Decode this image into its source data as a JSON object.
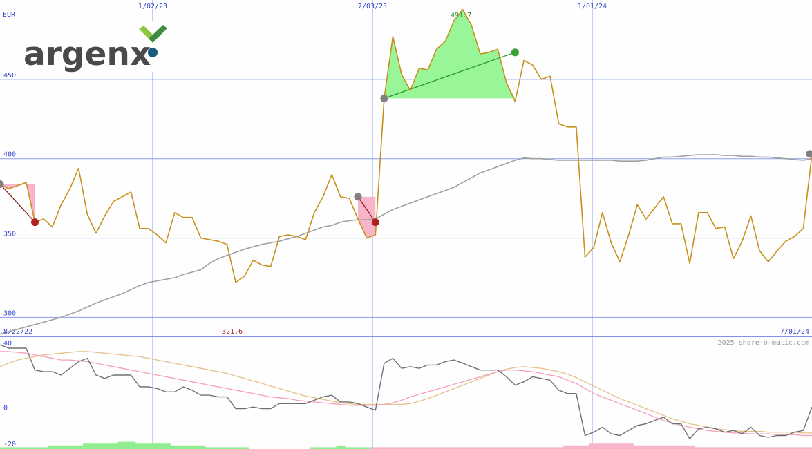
{
  "logo": {
    "text": "argenx",
    "mark_colors": {
      "chevron_light": "#8dc63f",
      "chevron_dark": "#3d8c40",
      "dot": "#1b5a7a",
      "text": "#4a4a4a"
    }
  },
  "watermark": "2025 share-o-matic.com",
  "colors": {
    "price": "#c8901a",
    "ma200": "#a0a0a0",
    "grid": "#8a9df0",
    "osc": "#707070",
    "osc_pink": "#f4a0b8",
    "osc_tan": "#e6c08a",
    "hist_pos": "#90ee90",
    "hist_neg": "#f8b4c8",
    "buy_dot": "#3aa03a",
    "sell_dot": "#b02020",
    "neutral_dot": "#808080",
    "gain_fill": "#98f598",
    "loss_fill": "#f8b4c8"
  },
  "chart_data": [
    {
      "type": "line",
      "currency_label": "EUR",
      "x_tick_labels": [
        "1/02/23",
        "7/03/23",
        "1/01/24"
      ],
      "y_ticks": [
        300,
        350,
        400,
        450
      ],
      "ylim": [
        288,
        500
      ],
      "start_label": "8/22/22",
      "end_label": "7/01/24",
      "min_label": "321.6",
      "max_label": "491.7",
      "grid": true,
      "series": [
        {
          "key": "price",
          "values": [
            384,
            381,
            383,
            385,
            360,
            362,
            357,
            371,
            381,
            394,
            365,
            353,
            364,
            373,
            376,
            379,
            356,
            356,
            352,
            347,
            366,
            363,
            363,
            350,
            349,
            348,
            346,
            322,
            326,
            336,
            333,
            332,
            351,
            352,
            351,
            349,
            366,
            376,
            390,
            376,
            375,
            362,
            350,
            352,
            438,
            477,
            453,
            443,
            457,
            456,
            469,
            474,
            487,
            494,
            484,
            466,
            467,
            469,
            448,
            436,
            462,
            459,
            450,
            452,
            422,
            420,
            420,
            338,
            344,
            366,
            347,
            335,
            352,
            371,
            362,
            369,
            376,
            359,
            359,
            334,
            366,
            366,
            356,
            357,
            337,
            348,
            364,
            342,
            335,
            342,
            348,
            351,
            356,
            403
          ]
        },
        {
          "key": "ma200",
          "values": [
            289.5,
            291,
            292.5,
            294,
            295.5,
            297,
            298.5,
            300,
            302,
            304,
            306.5,
            309,
            311,
            313,
            315,
            317.5,
            320,
            322,
            323,
            324,
            325,
            327,
            328.5,
            330,
            334,
            337,
            339,
            341,
            343,
            344.5,
            346,
            347,
            348,
            349.5,
            351,
            353,
            355,
            357,
            358,
            360,
            361,
            361.5,
            361.5,
            362,
            365,
            368,
            370,
            372,
            374,
            376,
            378,
            380,
            382,
            385,
            388,
            391,
            393,
            395,
            397,
            399,
            400.5,
            400,
            400,
            399.5,
            399,
            399,
            399,
            399,
            399,
            399,
            399,
            398.5,
            398.5,
            398.5,
            399,
            400,
            401,
            401,
            401.5,
            402,
            402.5,
            402.5,
            402.5,
            402,
            402,
            401.5,
            401.5,
            401,
            401,
            400.5,
            400,
            399.5,
            399,
            400
          ]
        }
      ],
      "signals": [
        {
          "from_index": 0,
          "from_value": 384,
          "to_index": 4,
          "to_value": 360,
          "result": "loss"
        },
        {
          "from_index": 41,
          "from_value": 376,
          "to_index": 43,
          "to_value": 360,
          "result": "loss"
        },
        {
          "from_index": 44,
          "from_value": 438,
          "to_index": 59,
          "to_value": 467,
          "result": "gain"
        }
      ],
      "last_marker_value": 403
    },
    {
      "type": "line",
      "y_ticks": [
        40,
        0,
        -20
      ],
      "ylim": [
        -22,
        45
      ],
      "grid": true,
      "series": [
        {
          "key": "oscillator",
          "values": [
            40,
            38,
            38,
            38,
            25,
            24,
            24,
            22,
            26,
            30,
            32,
            22,
            20,
            22,
            22,
            22,
            15,
            15,
            14,
            12,
            12,
            15,
            13,
            10,
            10,
            9,
            9,
            2,
            2,
            3,
            2,
            2,
            5,
            5,
            5,
            5,
            7,
            9,
            10,
            6,
            6,
            5,
            3,
            1,
            29,
            32,
            26,
            27,
            26,
            28,
            28,
            30,
            31,
            29,
            27,
            25,
            25,
            25,
            21,
            16,
            18,
            21,
            20,
            19,
            13,
            11,
            11,
            -14,
            -12,
            -9,
            -13,
            -14,
            -11,
            -8,
            -7,
            -5,
            -3,
            -7,
            -7,
            -16,
            -10,
            -9,
            -10,
            -12,
            -11,
            -13,
            -9,
            -14,
            -15,
            -14,
            -14,
            -12,
            -11,
            3
          ]
        },
        {
          "key": "signal_line",
          "values": [
            36,
            36,
            35.5,
            35,
            34,
            33,
            32,
            31,
            31,
            30.5,
            30,
            29,
            28,
            27,
            26,
            25,
            24,
            23,
            22,
            21,
            20,
            19,
            18,
            17,
            16,
            15,
            14,
            13,
            12,
            11,
            10,
            9,
            8.5,
            8,
            7,
            6.5,
            6,
            5.5,
            5,
            4.5,
            4,
            4,
            4,
            4,
            4.5,
            5.5,
            7,
            9,
            10.5,
            12,
            13.5,
            15,
            16.5,
            18,
            19.5,
            21,
            22.5,
            24,
            25,
            25,
            24.5,
            24,
            23,
            22,
            21,
            19,
            17,
            14,
            11,
            9,
            7,
            5,
            3,
            1,
            -1,
            -3,
            -5,
            -6.5,
            -8,
            -9,
            -10,
            -11,
            -11.5,
            -12,
            -12.5,
            -12.5,
            -13,
            -13,
            -13,
            -13.5,
            -13.5,
            -13.5,
            -14,
            -14
          ]
        },
        {
          "key": "slow_line",
          "values": [
            27,
            29,
            31,
            32,
            33,
            34,
            34.5,
            35,
            35.5,
            36,
            36,
            35.5,
            35,
            34.5,
            34,
            33.5,
            33,
            32,
            31,
            30,
            29,
            28,
            27,
            26,
            25,
            24,
            23,
            21.5,
            20,
            18.5,
            17,
            15.5,
            14,
            12.5,
            11,
            9.5,
            8.5,
            7.5,
            6.5,
            5.5,
            5,
            4.5,
            4.5,
            4.5,
            4.5,
            4.5,
            4.5,
            5,
            6.5,
            8,
            10,
            12,
            14,
            16,
            18,
            20,
            22,
            24,
            25.5,
            26.5,
            27,
            26.5,
            26,
            25,
            24,
            22.5,
            20.5,
            18,
            15.5,
            13,
            10.5,
            8,
            6,
            4,
            2,
            0,
            -2,
            -4,
            -5.5,
            -7,
            -8,
            -9,
            -10,
            -10.5,
            -11,
            -11.5,
            -11.5,
            -11.5,
            -12,
            -12,
            -12,
            -12,
            -12.5,
            -12.5
          ]
        }
      ],
      "histogram": [
        1,
        1,
        1,
        1,
        1,
        1,
        2,
        2,
        2,
        2,
        3,
        3,
        3,
        3,
        4,
        4,
        3,
        3,
        3,
        3,
        2,
        2,
        2,
        2,
        1,
        1,
        1,
        1,
        1,
        0,
        0,
        0,
        0,
        0,
        0,
        0,
        1,
        1,
        1,
        2,
        1,
        1,
        1,
        -1,
        -1,
        -1,
        -1,
        -1,
        -1,
        -1,
        -1,
        -1,
        -1,
        -1,
        -1,
        -1,
        -1,
        -1,
        -1,
        -1,
        -1,
        -1,
        -1,
        -1,
        -1,
        -2,
        -2,
        -2,
        -3,
        -3,
        -3,
        -3,
        -3,
        -2,
        -2,
        -2,
        -2,
        -2,
        -2,
        -2,
        -1,
        -1,
        -1,
        -1,
        -1,
        -1,
        -1,
        -1,
        -1,
        -1,
        -1,
        -1,
        -1,
        -1
      ]
    }
  ]
}
